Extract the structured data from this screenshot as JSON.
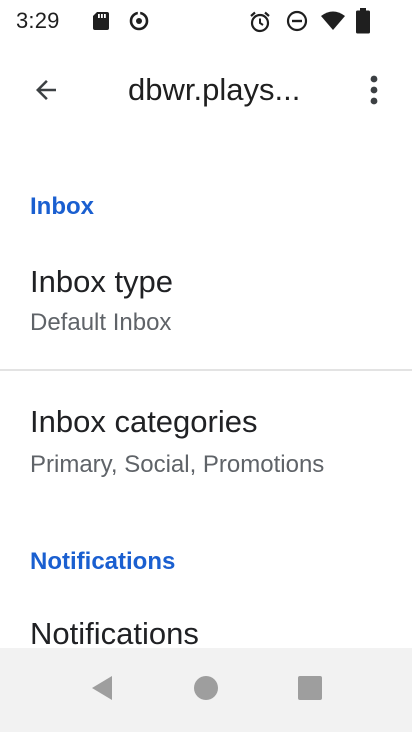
{
  "status_bar": {
    "time": "3:29",
    "left_icons": [
      "sd-card-icon",
      "data-saver-icon"
    ],
    "right_icons": [
      "alarm-icon",
      "do-not-disturb-icon",
      "wifi-icon",
      "battery-icon"
    ]
  },
  "app_bar": {
    "title": "dbwr.plays...",
    "back_icon": "arrow-back-icon",
    "overflow_icon": "more-vert-icon"
  },
  "sections": {
    "inbox": {
      "header": "Inbox",
      "items": [
        {
          "title": "Inbox type",
          "summary": "Default Inbox"
        },
        {
          "title": "Inbox categories",
          "summary": "Primary, Social, Promotions"
        }
      ]
    },
    "notifications": {
      "header": "Notifications",
      "items": [
        {
          "title": "Notifications"
        }
      ]
    }
  },
  "nav_bar": {
    "buttons": [
      "back-triangle-icon",
      "home-circle-icon",
      "recents-square-icon"
    ]
  },
  "colors": {
    "accent": "#1a5fd0",
    "title_text": "#202124",
    "summary_text": "#5f6368",
    "nav_bar_bg": "#f2f2f2",
    "nav_icon": "#9e9e9e"
  }
}
